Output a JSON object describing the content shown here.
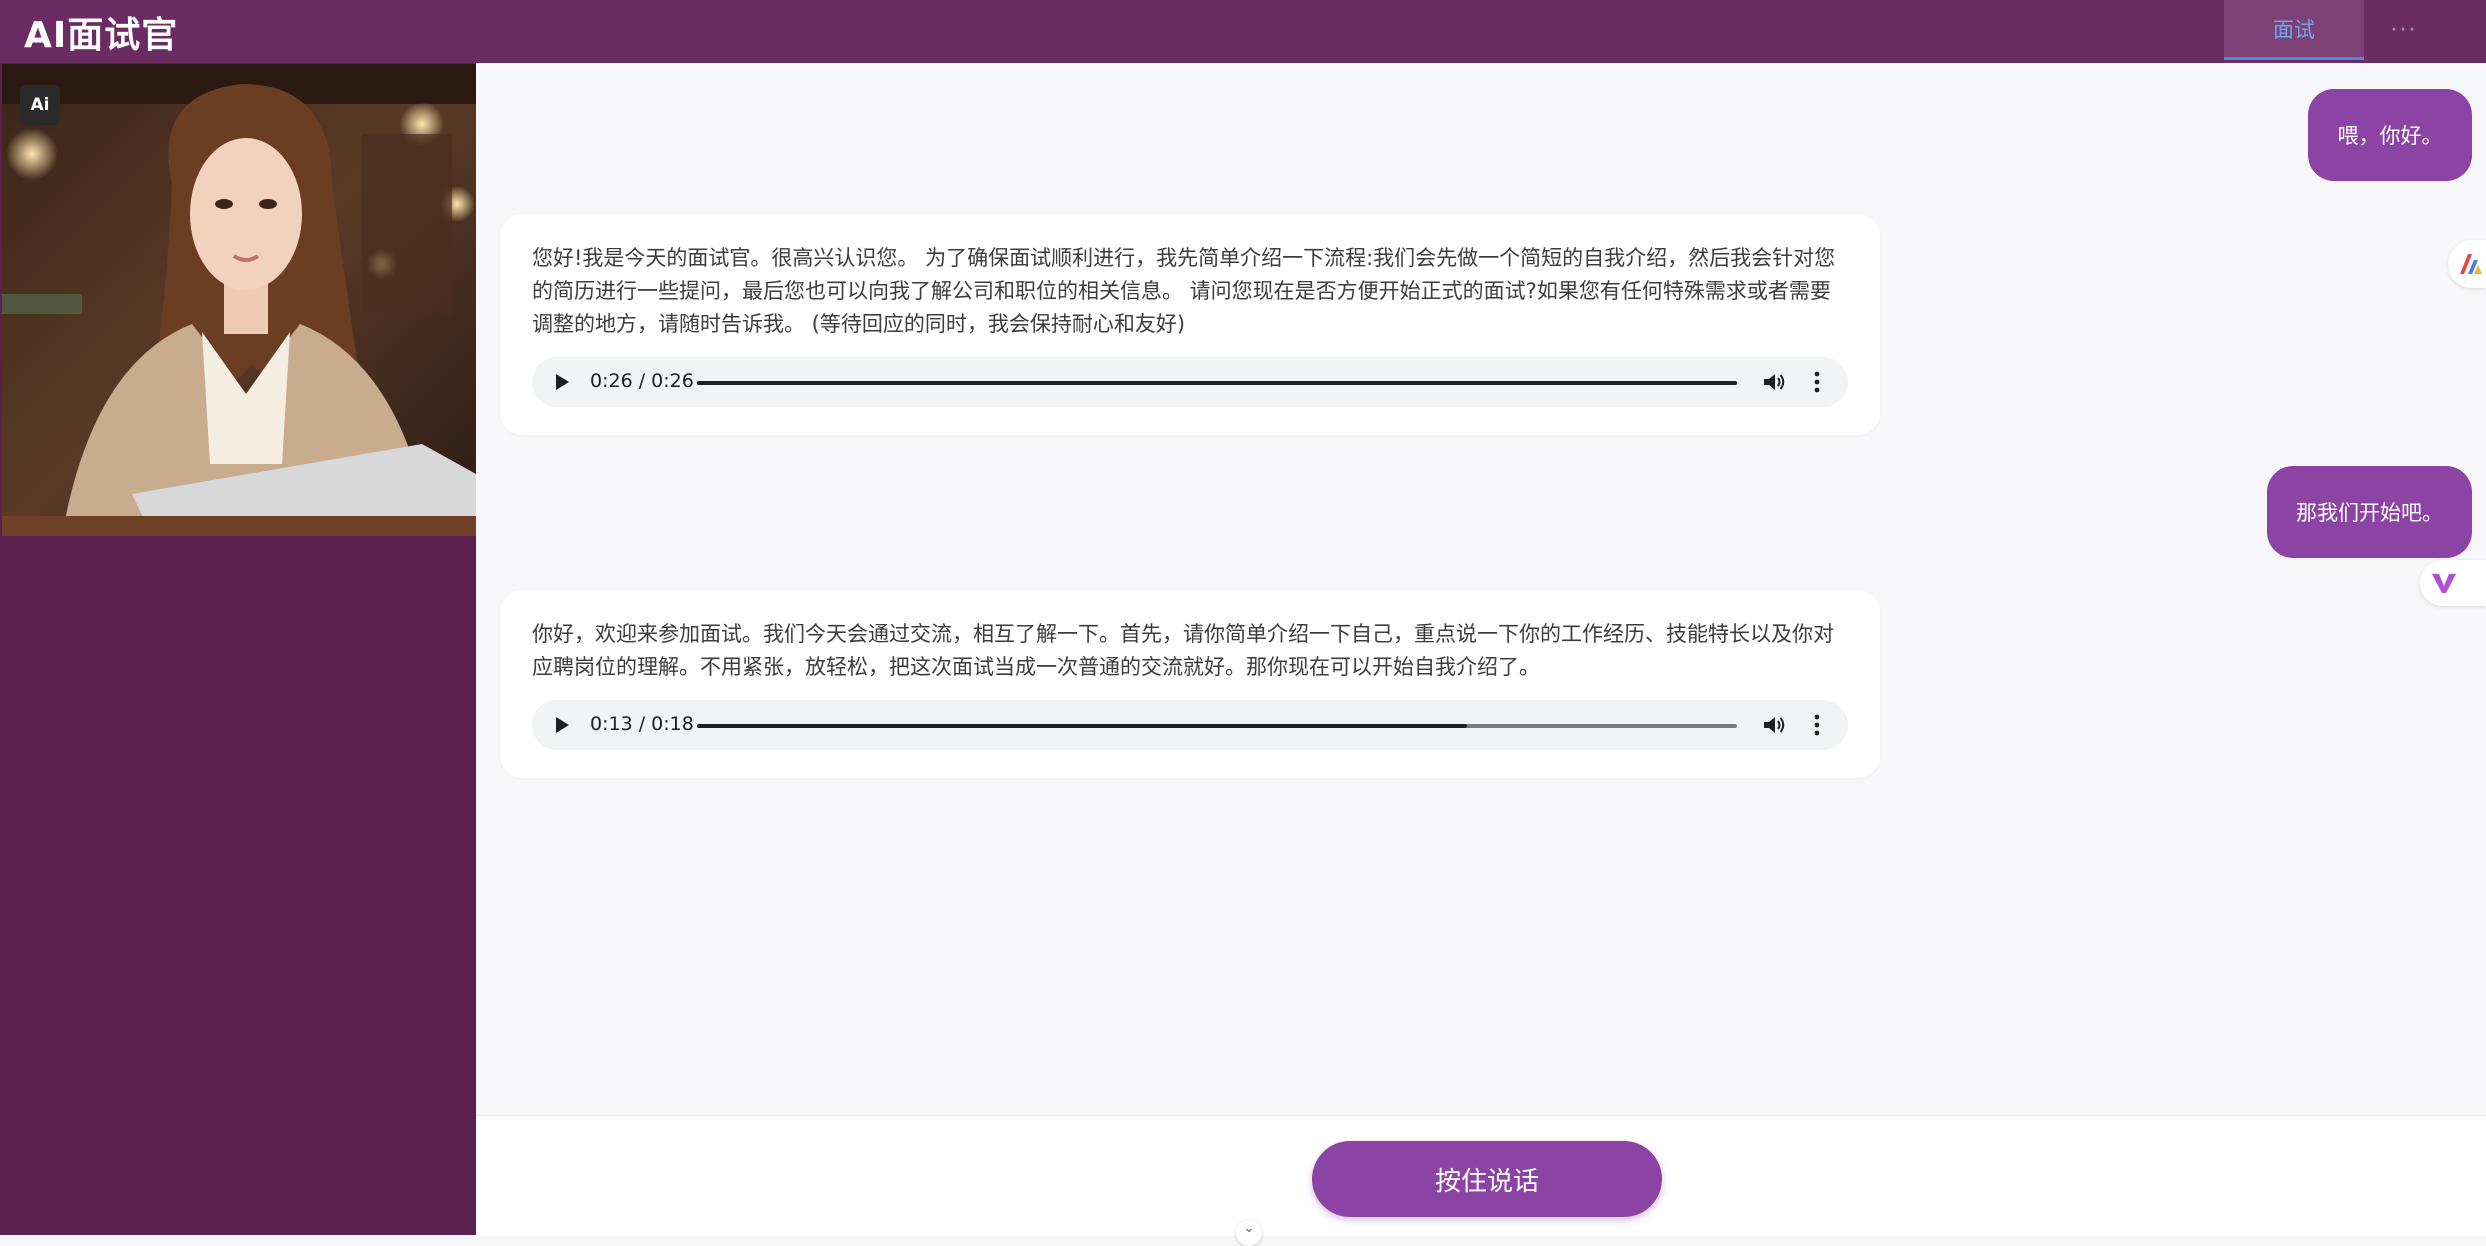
{
  "app": {
    "title": "AI面试官"
  },
  "header": {
    "tab_active": "面试",
    "more_label": "···"
  },
  "sidebar": {
    "badge": "Ai"
  },
  "chat": {
    "user_messages": [
      "喂，你好。",
      "那我们开始吧。"
    ],
    "ai_messages": [
      {
        "text": "您好!我是今天的面试官。很高兴认识您。 为了确保面试顺利进行，我先简单介绍一下流程:我们会先做一个简短的自我介绍，然后我会针对您的简历进行一些提问，最后您也可以向我了解公司和职位的相关信息。 请问您现在是否方便开始正式的面试?如果您有任何特殊需求或者需要调整的地方，请随时告诉我。 (等待回应的同时，我会保持耐心和友好)",
        "audio_time": "0:26 / 0:26",
        "audio_progress": 1.0
      },
      {
        "text": "你好，欢迎来参加面试。我们今天会通过交流，相互了解一下。首先，请你简单介绍一下自己，重点说一下你的工作经历、技能特长以及你对应聘岗位的理解。不用紧张，放轻松，把这次面试当成一次普通的交流就好。那你现在可以开始自我介绍了。",
        "audio_time": "0:13 / 0:18",
        "audio_progress": 0.74
      }
    ]
  },
  "footer": {
    "talk_button": "按住说话"
  },
  "colors": {
    "header": "#6b2b63",
    "sidebar": "#5b2050",
    "accent": "#8c44a4",
    "tab_text": "#6fa6ef"
  }
}
